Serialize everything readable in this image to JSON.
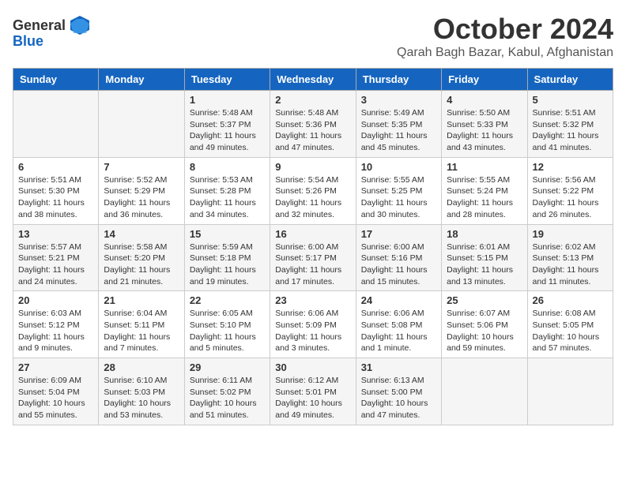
{
  "header": {
    "logo_general": "General",
    "logo_blue": "Blue",
    "month": "October 2024",
    "location": "Qarah Bagh Bazar, Kabul, Afghanistan"
  },
  "days_of_week": [
    "Sunday",
    "Monday",
    "Tuesday",
    "Wednesday",
    "Thursday",
    "Friday",
    "Saturday"
  ],
  "weeks": [
    [
      {
        "day": "",
        "info": ""
      },
      {
        "day": "",
        "info": ""
      },
      {
        "day": "1",
        "info": "Sunrise: 5:48 AM\nSunset: 5:37 PM\nDaylight: 11 hours and 49 minutes."
      },
      {
        "day": "2",
        "info": "Sunrise: 5:48 AM\nSunset: 5:36 PM\nDaylight: 11 hours and 47 minutes."
      },
      {
        "day": "3",
        "info": "Sunrise: 5:49 AM\nSunset: 5:35 PM\nDaylight: 11 hours and 45 minutes."
      },
      {
        "day": "4",
        "info": "Sunrise: 5:50 AM\nSunset: 5:33 PM\nDaylight: 11 hours and 43 minutes."
      },
      {
        "day": "5",
        "info": "Sunrise: 5:51 AM\nSunset: 5:32 PM\nDaylight: 11 hours and 41 minutes."
      }
    ],
    [
      {
        "day": "6",
        "info": "Sunrise: 5:51 AM\nSunset: 5:30 PM\nDaylight: 11 hours and 38 minutes."
      },
      {
        "day": "7",
        "info": "Sunrise: 5:52 AM\nSunset: 5:29 PM\nDaylight: 11 hours and 36 minutes."
      },
      {
        "day": "8",
        "info": "Sunrise: 5:53 AM\nSunset: 5:28 PM\nDaylight: 11 hours and 34 minutes."
      },
      {
        "day": "9",
        "info": "Sunrise: 5:54 AM\nSunset: 5:26 PM\nDaylight: 11 hours and 32 minutes."
      },
      {
        "day": "10",
        "info": "Sunrise: 5:55 AM\nSunset: 5:25 PM\nDaylight: 11 hours and 30 minutes."
      },
      {
        "day": "11",
        "info": "Sunrise: 5:55 AM\nSunset: 5:24 PM\nDaylight: 11 hours and 28 minutes."
      },
      {
        "day": "12",
        "info": "Sunrise: 5:56 AM\nSunset: 5:22 PM\nDaylight: 11 hours and 26 minutes."
      }
    ],
    [
      {
        "day": "13",
        "info": "Sunrise: 5:57 AM\nSunset: 5:21 PM\nDaylight: 11 hours and 24 minutes."
      },
      {
        "day": "14",
        "info": "Sunrise: 5:58 AM\nSunset: 5:20 PM\nDaylight: 11 hours and 21 minutes."
      },
      {
        "day": "15",
        "info": "Sunrise: 5:59 AM\nSunset: 5:18 PM\nDaylight: 11 hours and 19 minutes."
      },
      {
        "day": "16",
        "info": "Sunrise: 6:00 AM\nSunset: 5:17 PM\nDaylight: 11 hours and 17 minutes."
      },
      {
        "day": "17",
        "info": "Sunrise: 6:00 AM\nSunset: 5:16 PM\nDaylight: 11 hours and 15 minutes."
      },
      {
        "day": "18",
        "info": "Sunrise: 6:01 AM\nSunset: 5:15 PM\nDaylight: 11 hours and 13 minutes."
      },
      {
        "day": "19",
        "info": "Sunrise: 6:02 AM\nSunset: 5:13 PM\nDaylight: 11 hours and 11 minutes."
      }
    ],
    [
      {
        "day": "20",
        "info": "Sunrise: 6:03 AM\nSunset: 5:12 PM\nDaylight: 11 hours and 9 minutes."
      },
      {
        "day": "21",
        "info": "Sunrise: 6:04 AM\nSunset: 5:11 PM\nDaylight: 11 hours and 7 minutes."
      },
      {
        "day": "22",
        "info": "Sunrise: 6:05 AM\nSunset: 5:10 PM\nDaylight: 11 hours and 5 minutes."
      },
      {
        "day": "23",
        "info": "Sunrise: 6:06 AM\nSunset: 5:09 PM\nDaylight: 11 hours and 3 minutes."
      },
      {
        "day": "24",
        "info": "Sunrise: 6:06 AM\nSunset: 5:08 PM\nDaylight: 11 hours and 1 minute."
      },
      {
        "day": "25",
        "info": "Sunrise: 6:07 AM\nSunset: 5:06 PM\nDaylight: 10 hours and 59 minutes."
      },
      {
        "day": "26",
        "info": "Sunrise: 6:08 AM\nSunset: 5:05 PM\nDaylight: 10 hours and 57 minutes."
      }
    ],
    [
      {
        "day": "27",
        "info": "Sunrise: 6:09 AM\nSunset: 5:04 PM\nDaylight: 10 hours and 55 minutes."
      },
      {
        "day": "28",
        "info": "Sunrise: 6:10 AM\nSunset: 5:03 PM\nDaylight: 10 hours and 53 minutes."
      },
      {
        "day": "29",
        "info": "Sunrise: 6:11 AM\nSunset: 5:02 PM\nDaylight: 10 hours and 51 minutes."
      },
      {
        "day": "30",
        "info": "Sunrise: 6:12 AM\nSunset: 5:01 PM\nDaylight: 10 hours and 49 minutes."
      },
      {
        "day": "31",
        "info": "Sunrise: 6:13 AM\nSunset: 5:00 PM\nDaylight: 10 hours and 47 minutes."
      },
      {
        "day": "",
        "info": ""
      },
      {
        "day": "",
        "info": ""
      }
    ]
  ]
}
